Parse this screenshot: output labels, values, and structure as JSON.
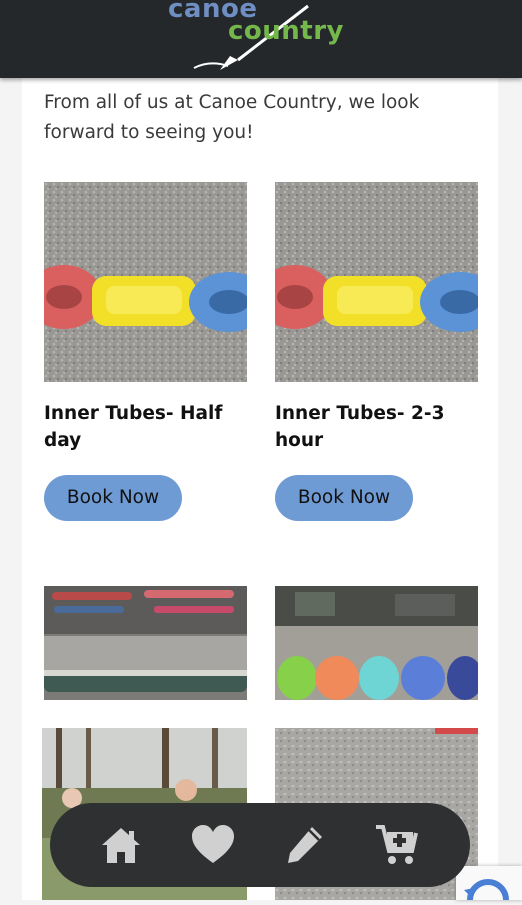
{
  "header": {
    "logo_word1": "canoe",
    "logo_word2": "country",
    "background": "#25282b",
    "logo_blue": "#6f8fc4",
    "logo_green": "#74b84c"
  },
  "intro": {
    "text": "From all of us at Canoe Country, we look forward to seeing you!"
  },
  "products": [
    {
      "title": "Inner Tubes- Half day",
      "button": "Book Now",
      "image": "inner-tubes-photo"
    },
    {
      "title": "Inner Tubes- 2-3 hour",
      "button": "Book Now",
      "image": "inner-tubes-photo"
    }
  ],
  "thumbnails": [
    {
      "image": "canoes-on-racks-photo"
    },
    {
      "image": "colorful-kayaks-photo"
    },
    {
      "image": "people-in-woods-photo"
    },
    {
      "image": "gravel-photo"
    }
  ],
  "accent_color": "#6f9bd5",
  "bottom_nav": {
    "items": [
      {
        "icon": "home-icon"
      },
      {
        "icon": "heart-icon"
      },
      {
        "icon": "pencil-icon"
      },
      {
        "icon": "cart-add-icon"
      }
    ],
    "background": "#2e3032",
    "icon_color": "#d0d0d0"
  },
  "recaptcha": {
    "icon": "recaptcha-icon"
  }
}
